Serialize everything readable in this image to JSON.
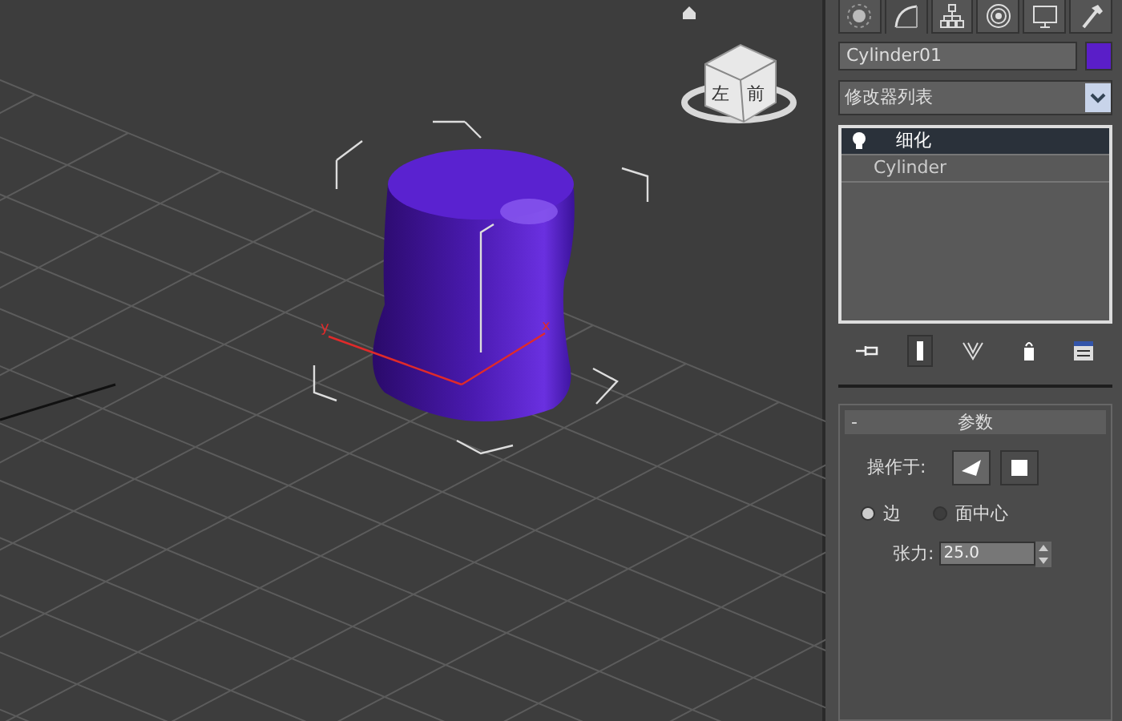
{
  "viewport": {
    "viewcube_faces": [
      "左",
      "前"
    ],
    "gizmo_labels": [
      "y",
      "x"
    ]
  },
  "command_tabs": [
    {
      "kind": "create",
      "selected": false
    },
    {
      "kind": "modify",
      "selected": true
    },
    {
      "kind": "hierarchy",
      "selected": false
    },
    {
      "kind": "motion",
      "selected": false
    },
    {
      "kind": "display",
      "selected": false
    },
    {
      "kind": "utilities",
      "selected": false
    }
  ],
  "object_name": {
    "value": "Cylinder01",
    "color": "#5a1ec8"
  },
  "modifier_list": {
    "label": "修改器列表"
  },
  "modifier_stack": [
    {
      "label": "细化",
      "kind": "modifier",
      "selected": true
    },
    {
      "label": "Cylinder",
      "kind": "base",
      "selected": false
    }
  ],
  "stack_tools": [
    {
      "kind": "pin",
      "selected": false
    },
    {
      "kind": "show-end",
      "selected": true
    },
    {
      "kind": "unique",
      "selected": false
    },
    {
      "kind": "remove",
      "selected": false
    },
    {
      "kind": "configure",
      "selected": false
    }
  ],
  "rollout": {
    "collapse": "-",
    "title": "参数",
    "operate_on_label": "操作于:",
    "operate_on": [
      {
        "kind": "triangle",
        "selected": true
      },
      {
        "kind": "square",
        "selected": false
      }
    ],
    "radios": [
      {
        "label": "边",
        "selected": true
      },
      {
        "label": "面中心",
        "selected": false
      }
    ],
    "tension": {
      "label": "张力:",
      "value": "25.0"
    }
  }
}
